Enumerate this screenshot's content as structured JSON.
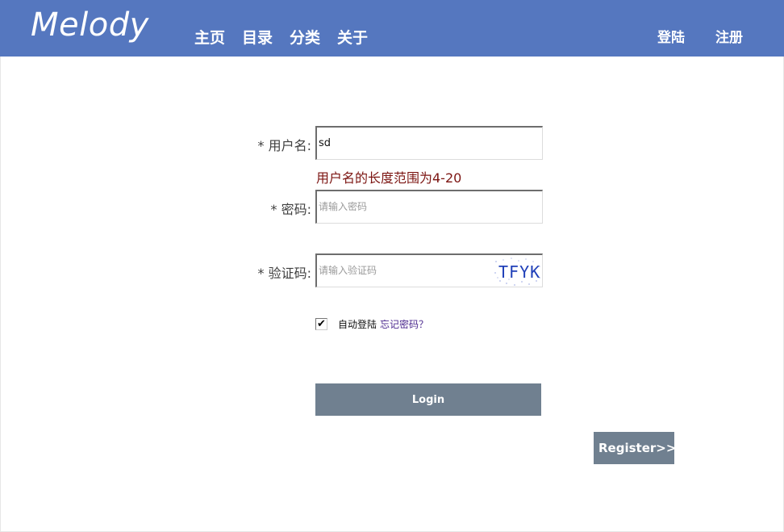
{
  "brand": {
    "logo": "Melody",
    "color": "#5577bf"
  },
  "nav": {
    "left": [
      "主页",
      "目录",
      "分类",
      "关于"
    ],
    "right": [
      "登陆",
      "注册"
    ]
  },
  "form": {
    "username": {
      "label": "* 用户名:",
      "value": "sd",
      "placeholder": ""
    },
    "username_error": "用户名的长度范围为4-20",
    "password": {
      "label": "* 密码:",
      "value": "",
      "placeholder": "请输入密码"
    },
    "captcha": {
      "label": "* 验证码:",
      "value": "",
      "placeholder": "请输入验证码",
      "image_text": "TFYK"
    },
    "auto_login": {
      "label": "自动登陆",
      "checked": true
    },
    "forgot_password": "忘记密码？",
    "login_button": "Login",
    "register_button": "Register>>"
  },
  "colors": {
    "button": "#708090",
    "error": "#7c1512",
    "link": "#4c2a8f"
  }
}
